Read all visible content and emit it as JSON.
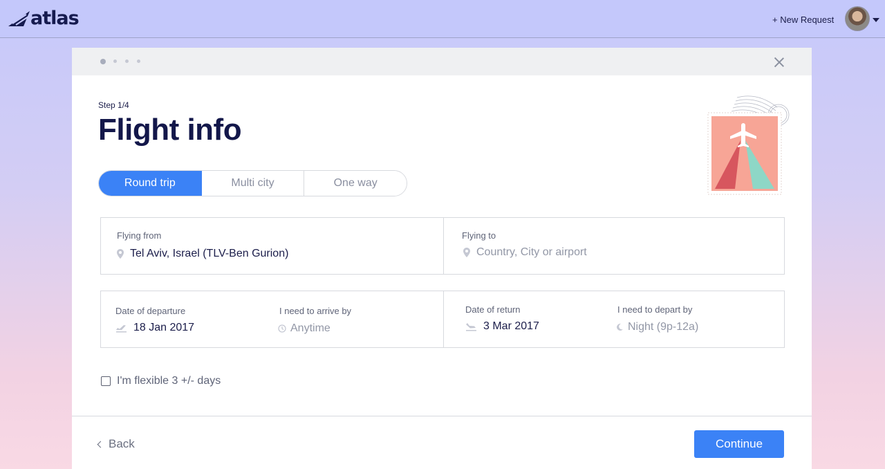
{
  "topbar": {
    "brand": "atlas",
    "new_request_label": "+ New Request"
  },
  "wizard": {
    "steps_total": 4,
    "current_step": 1,
    "step_label": "Step 1/4",
    "title": "Flight info"
  },
  "trip_type": {
    "options": [
      "Round trip",
      "Multi city",
      "One way"
    ],
    "selected": "Round trip"
  },
  "route": {
    "from_label": "Flying from",
    "from_value": "Tel Aviv, Israel (TLV-Ben Gurion)",
    "to_label": "Flying to",
    "to_placeholder": "Country, City or airport"
  },
  "dates": {
    "departure_label": "Date of departure",
    "departure_value": "18 Jan 2017",
    "arrive_by_label": "I need to arrive by",
    "arrive_by_value": "Anytime",
    "return_label": "Date of return",
    "return_value": "3 Mar 2017",
    "depart_by_label": "I need to depart by",
    "depart_by_value": "Night (9p-12a)"
  },
  "flexible": {
    "label": "I'm flexible 3 +/- days",
    "checked": false
  },
  "footer": {
    "back_label": "Back",
    "continue_label": "Continue"
  },
  "colors": {
    "accent": "#3b82f6",
    "brand_navy": "#13174a",
    "stamp": "#f7a596"
  },
  "icons": {
    "location": "location-pin-icon",
    "departure": "plane-takeoff-icon",
    "return": "plane-landing-icon",
    "clock": "clock-icon",
    "night": "moon-icon",
    "close": "close-icon"
  }
}
